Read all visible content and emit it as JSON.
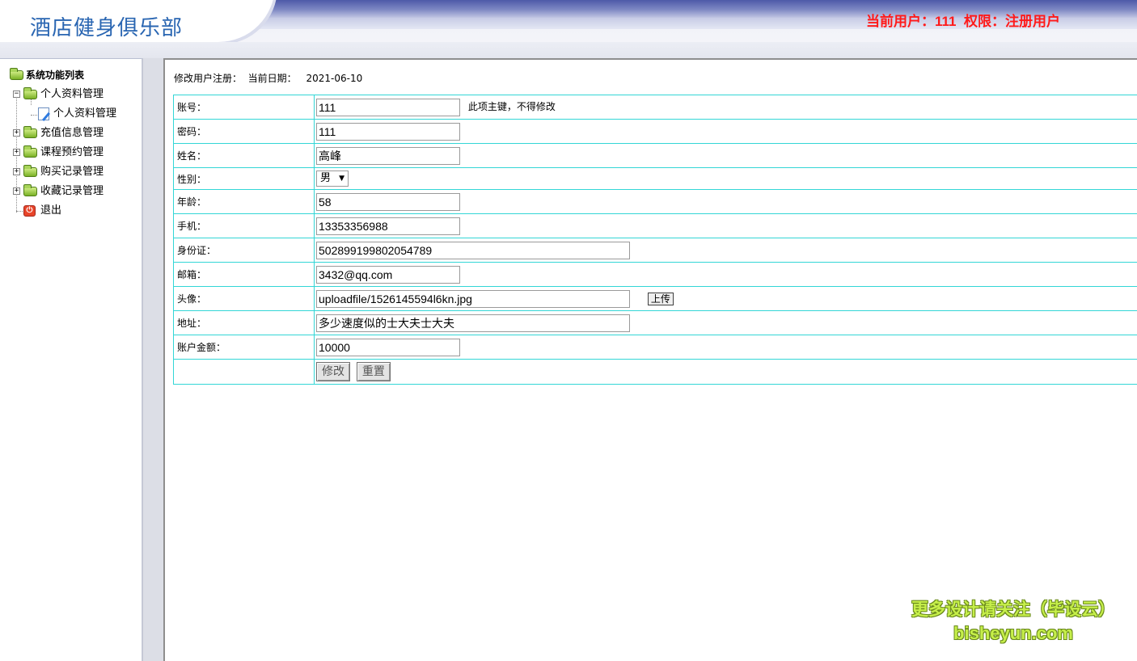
{
  "header": {
    "site_title": "酒店健身俱乐部",
    "current_user_label": "当前用户：",
    "current_user_value": "111",
    "permission_label": "权限：",
    "permission_value": "注册用户"
  },
  "sidebar": {
    "root_label": "系统功能列表",
    "items": [
      {
        "label": "个人资料管理",
        "expanded": true,
        "toggle": "−"
      },
      {
        "label": "个人资料管理",
        "child": true
      },
      {
        "label": "充值信息管理",
        "toggle": "+"
      },
      {
        "label": "课程预约管理",
        "toggle": "+"
      },
      {
        "label": "购买记录管理",
        "toggle": "+"
      },
      {
        "label": "收藏记录管理",
        "toggle": "+"
      },
      {
        "label": "退出",
        "exit": true
      }
    ]
  },
  "main": {
    "breadcrumb": "修改用户注册：",
    "date_label": "当前日期：",
    "date_value": "2021-06-10",
    "form": {
      "account": {
        "label": "账号：",
        "value": "111",
        "note": "此项主键，不得修改"
      },
      "password": {
        "label": "密码：",
        "value": "111"
      },
      "name": {
        "label": "姓名：",
        "value": "高峰"
      },
      "gender": {
        "label": "性别：",
        "value": "男"
      },
      "age": {
        "label": "年龄：",
        "value": "58"
      },
      "phone": {
        "label": "手机：",
        "value": "13353356988"
      },
      "id_card": {
        "label": "身份证：",
        "value": "502899199802054789"
      },
      "email": {
        "label": "邮箱：",
        "value": "3432@qq.com"
      },
      "avatar": {
        "label": "头像：",
        "value": "uploadfile/1526145594l6kn.jpg",
        "upload_label": "上传"
      },
      "address": {
        "label": "地址：",
        "value": "多少速度似的士大夫士大夫"
      },
      "balance": {
        "label": "账户金额：",
        "value": "10000"
      },
      "submit_label": "修改",
      "reset_label": "重置"
    }
  },
  "watermark": {
    "line1": "更多设计请关注（毕设云）",
    "line2": "bisheyun.com"
  },
  "colors": {
    "title_blue": "#2a66b2",
    "user_red": "#ff1a1a",
    "table_border": "#33d6d6",
    "watermark_green": "#c6ef4a"
  }
}
